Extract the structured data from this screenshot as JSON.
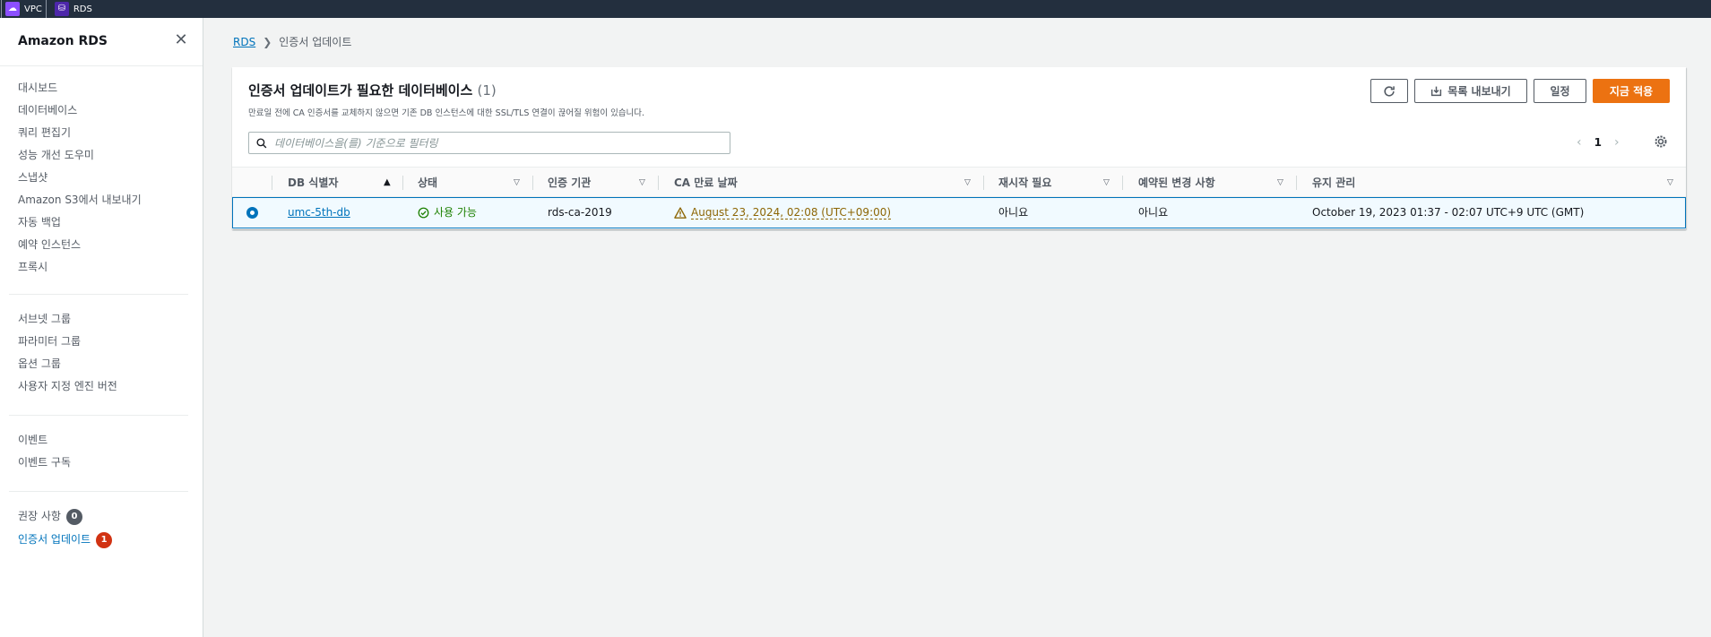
{
  "topbar": {
    "services": [
      {
        "label": "VPC",
        "icon": "vpc-icon"
      },
      {
        "label": "RDS",
        "icon": "rds-icon"
      }
    ]
  },
  "sidebar": {
    "title": "Amazon RDS",
    "group1": [
      "대시보드",
      "데이터베이스",
      "쿼리 편집기",
      "성능 개선 도우미",
      "스냅샷",
      "Amazon S3에서 내보내기",
      "자동 백업",
      "예약 인스턴스",
      "프록시"
    ],
    "group2": [
      "서브넷 그룹",
      "파라미터 그룹",
      "옵션 그룹",
      "사용자 지정 엔진 버전"
    ],
    "group3": [
      "이벤트",
      "이벤트 구독"
    ],
    "group4": [
      {
        "label": "권장 사항",
        "badge": "0"
      },
      {
        "label": "인증서 업데이트",
        "badge": "1"
      }
    ]
  },
  "breadcrumb": {
    "root": "RDS",
    "current": "인증서 업데이트"
  },
  "panel": {
    "title": "인증서 업데이트가 필요한 데이터베이스",
    "count": "(1)",
    "description": "만료일 전에 CA 인증서를 교체하지 않으면 기존 DB 인스턴스에 대한 SSL/TLS 연결이 끊어질 위험이 있습니다.",
    "buttons": {
      "export": "목록 내보내기",
      "schedule": "일정",
      "apply_now": "지금 적용"
    },
    "search_placeholder": "데이터베이스을(를) 기준으로 필터링",
    "page": "1"
  },
  "table": {
    "columns": [
      "DB 식별자",
      "상태",
      "인증 기관",
      "CA 만료 날짜",
      "재시작 필요",
      "예약된 변경 사항",
      "유지 관리"
    ],
    "rows": [
      {
        "db_id": "umc-5th-db",
        "status": "사용 가능",
        "ca": "rds-ca-2019",
        "ca_expiry": "August 23, 2024, 02:08 (UTC+09:00)",
        "restart": "아니요",
        "pending": "아니요",
        "maintenance": "October 19, 2023 01:37 - 02:07 UTC+9 UTC (GMT)"
      }
    ]
  }
}
